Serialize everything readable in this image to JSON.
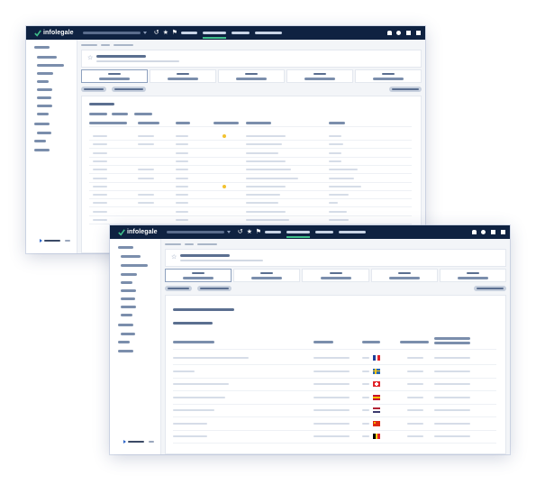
{
  "app": {
    "brand": "infolegale",
    "colors": {
      "topbar": "#0f2241",
      "accent_green": "#3fbf8a",
      "sidebar_bar": "#7b8eac",
      "cell_bar": "#d6dde8",
      "highlight_dot": "#f2c230"
    }
  },
  "flags": {
    "france": {
      "colors": [
        "#1d3f9a",
        "#ffffff",
        "#e2252b"
      ],
      "layout": "vertical"
    },
    "sweden": {
      "colors": [
        "#2a69b0",
        "#f4c51b"
      ],
      "layout": "cross"
    },
    "switzerland": {
      "colors": [
        "#e2252b",
        "#ffffff"
      ],
      "layout": "plus"
    },
    "spain": {
      "colors": [
        "#c8102e",
        "#f6c200",
        "#c8102e"
      ],
      "layout": "horizontal"
    },
    "usa": {
      "colors": [
        "#b22234",
        "#ffffff",
        "#3c3b6e"
      ],
      "layout": "stripes"
    },
    "china": {
      "colors": [
        "#de2910",
        "#ffde00"
      ],
      "layout": "solid"
    },
    "belgium": {
      "colors": [
        "#000000",
        "#f6d118",
        "#e2252b"
      ],
      "layout": "vertical"
    }
  },
  "icons": {
    "logo": "check-mark-icon",
    "star": "star-icon",
    "bell": "bell-icon",
    "grid": "grid-icon",
    "user": "user-icon",
    "history": "history-icon",
    "flag_nav": "flag-icon",
    "collapse": "collapse-arrow-icon"
  }
}
